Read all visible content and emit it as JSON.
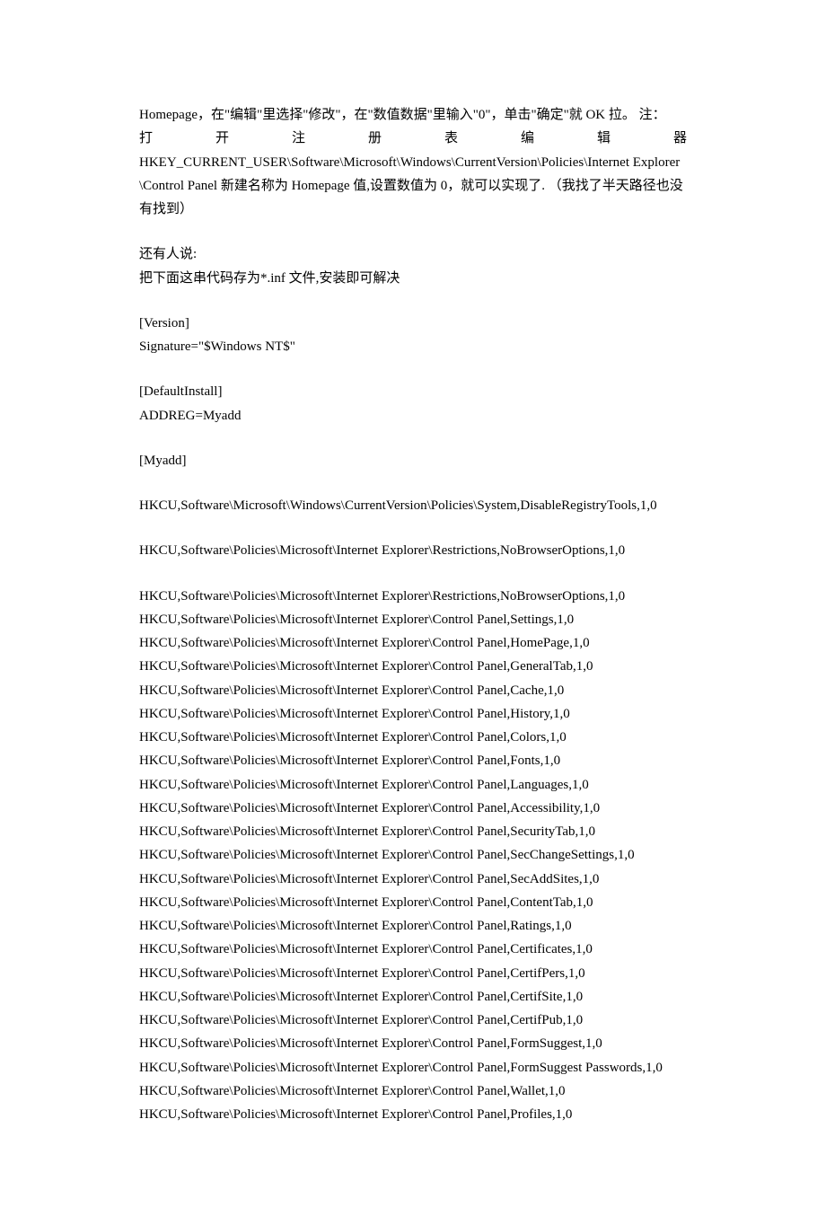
{
  "para1a": "Homepage，在\"编辑\"里选择\"修改\"，在\"数值数据\"里输入\"0\"，单击\"确定\"就 OK 拉。  注：",
  "para1b": "打开注册表编辑器",
  "para1c": "HKEY_CURRENT_USER\\Software\\Microsoft\\Windows\\CurrentVersion\\Policies\\Internet Explorer\\Control Panel 新建名称为 Homepage 值,设置数值为 0，就可以实现了.  （我找了半天路径也没有找到）",
  "para2": "还有人说:",
  "para3": "把下面这串代码存为*.inf 文件,安装即可解决",
  "line_version": "[Version]",
  "line_sig": "Signature=\"$Windows NT$\"",
  "line_definstall": "[DefaultInstall]",
  "line_addreg": "ADDREG=Myadd",
  "line_myadd": "[Myadd]",
  "reg1": "HKCU,Software\\Microsoft\\Windows\\CurrentVersion\\Policies\\System,DisableRegistryTools,1,0",
  "reg2": "HKCU,Software\\Policies\\Microsoft\\Internet Explorer\\Restrictions,NoBrowserOptions,1,0",
  "reg3": "HKCU,Software\\Policies\\Microsoft\\Internet Explorer\\Restrictions,NoBrowserOptions,1,0",
  "reg4": "HKCU,Software\\Policies\\Microsoft\\Internet Explorer\\Control Panel,Settings,1,0",
  "reg5": "HKCU,Software\\Policies\\Microsoft\\Internet Explorer\\Control Panel,HomePage,1,0",
  "reg6": "HKCU,Software\\Policies\\Microsoft\\Internet Explorer\\Control Panel,GeneralTab,1,0",
  "reg7": "HKCU,Software\\Policies\\Microsoft\\Internet Explorer\\Control Panel,Cache,1,0",
  "reg8": "HKCU,Software\\Policies\\Microsoft\\Internet Explorer\\Control Panel,History,1,0",
  "reg9": "HKCU,Software\\Policies\\Microsoft\\Internet Explorer\\Control Panel,Colors,1,0",
  "reg10": "HKCU,Software\\Policies\\Microsoft\\Internet Explorer\\Control Panel,Fonts,1,0",
  "reg11": "HKCU,Software\\Policies\\Microsoft\\Internet Explorer\\Control Panel,Languages,1,0",
  "reg12": "HKCU,Software\\Policies\\Microsoft\\Internet Explorer\\Control Panel,Accessibility,1,0",
  "reg13": "HKCU,Software\\Policies\\Microsoft\\Internet Explorer\\Control Panel,SecurityTab,1,0",
  "reg14": "HKCU,Software\\Policies\\Microsoft\\Internet Explorer\\Control Panel,SecChangeSettings,1,0",
  "reg15": "HKCU,Software\\Policies\\Microsoft\\Internet Explorer\\Control Panel,SecAddSites,1,0",
  "reg16": "HKCU,Software\\Policies\\Microsoft\\Internet Explorer\\Control Panel,ContentTab,1,0",
  "reg17": "HKCU,Software\\Policies\\Microsoft\\Internet Explorer\\Control Panel,Ratings,1,0",
  "reg18": "HKCU,Software\\Policies\\Microsoft\\Internet Explorer\\Control Panel,Certificates,1,0",
  "reg19": "HKCU,Software\\Policies\\Microsoft\\Internet Explorer\\Control Panel,CertifPers,1,0",
  "reg20": "HKCU,Software\\Policies\\Microsoft\\Internet Explorer\\Control Panel,CertifSite,1,0",
  "reg21": "HKCU,Software\\Policies\\Microsoft\\Internet Explorer\\Control Panel,CertifPub,1,0",
  "reg22": "HKCU,Software\\Policies\\Microsoft\\Internet Explorer\\Control Panel,FormSuggest,1,0",
  "reg23": "HKCU,Software\\Policies\\Microsoft\\Internet Explorer\\Control Panel,FormSuggest Passwords,1,0",
  "reg24": "HKCU,Software\\Policies\\Microsoft\\Internet Explorer\\Control Panel,Wallet,1,0",
  "reg25": "HKCU,Software\\Policies\\Microsoft\\Internet Explorer\\Control Panel,Profiles,1,0"
}
